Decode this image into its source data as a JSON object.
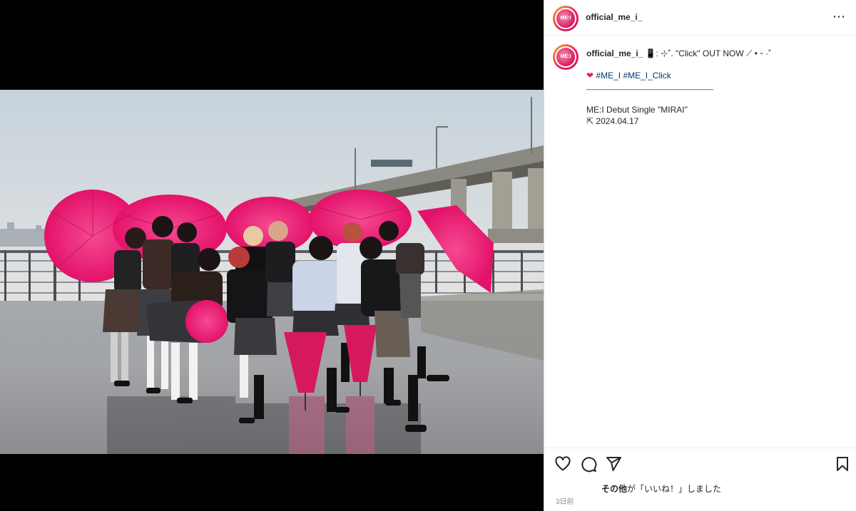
{
  "post": {
    "username": "official_me_i_",
    "avatar_text": "ME:I",
    "more_icon": "⋯",
    "caption": {
      "username": "official_me_i_",
      "line1": "📱: ⊹˚. \"Click\" OUT NOW ⟋ • ᵕ ·˚",
      "hashtag1": "#ME_I",
      "hashtag2": "#ME_I_Click",
      "divider": "________________________________",
      "line3": "ME:I Debut Single \"MIRAI\"",
      "line4": "⇱ 2024.04.17"
    },
    "likes_text_bold": "その他",
    "likes_text_rest": "が「いいね！」しました",
    "time_ago": "3日前"
  },
  "colors": {
    "umbrella": "#e8196f",
    "panel_bg": "#ffffff",
    "text": "#262626",
    "link": "#00376b"
  },
  "icons": [
    "heart-icon",
    "comment-icon",
    "share-icon",
    "bookmark-icon",
    "more-icon"
  ]
}
